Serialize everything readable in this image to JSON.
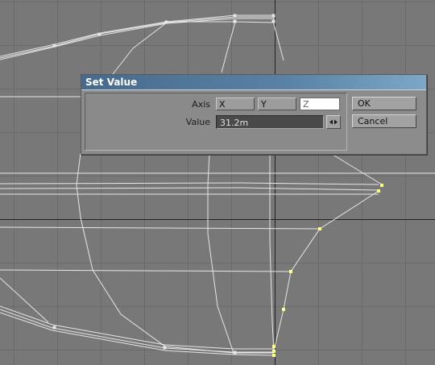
{
  "dialog": {
    "title": "Set Value",
    "axis_label": "Axis",
    "axis_options": [
      "X",
      "Y",
      "Z"
    ],
    "axis_selected": "Z",
    "value_label": "Value",
    "value": "31.2m",
    "ok_label": "OK",
    "cancel_label": "Cancel"
  },
  "viewport": {
    "background_color": "#787878",
    "grid_color": "#6a6a6a",
    "wire_color": "#e6e6e6",
    "selected_point_color": "#ffff80"
  }
}
